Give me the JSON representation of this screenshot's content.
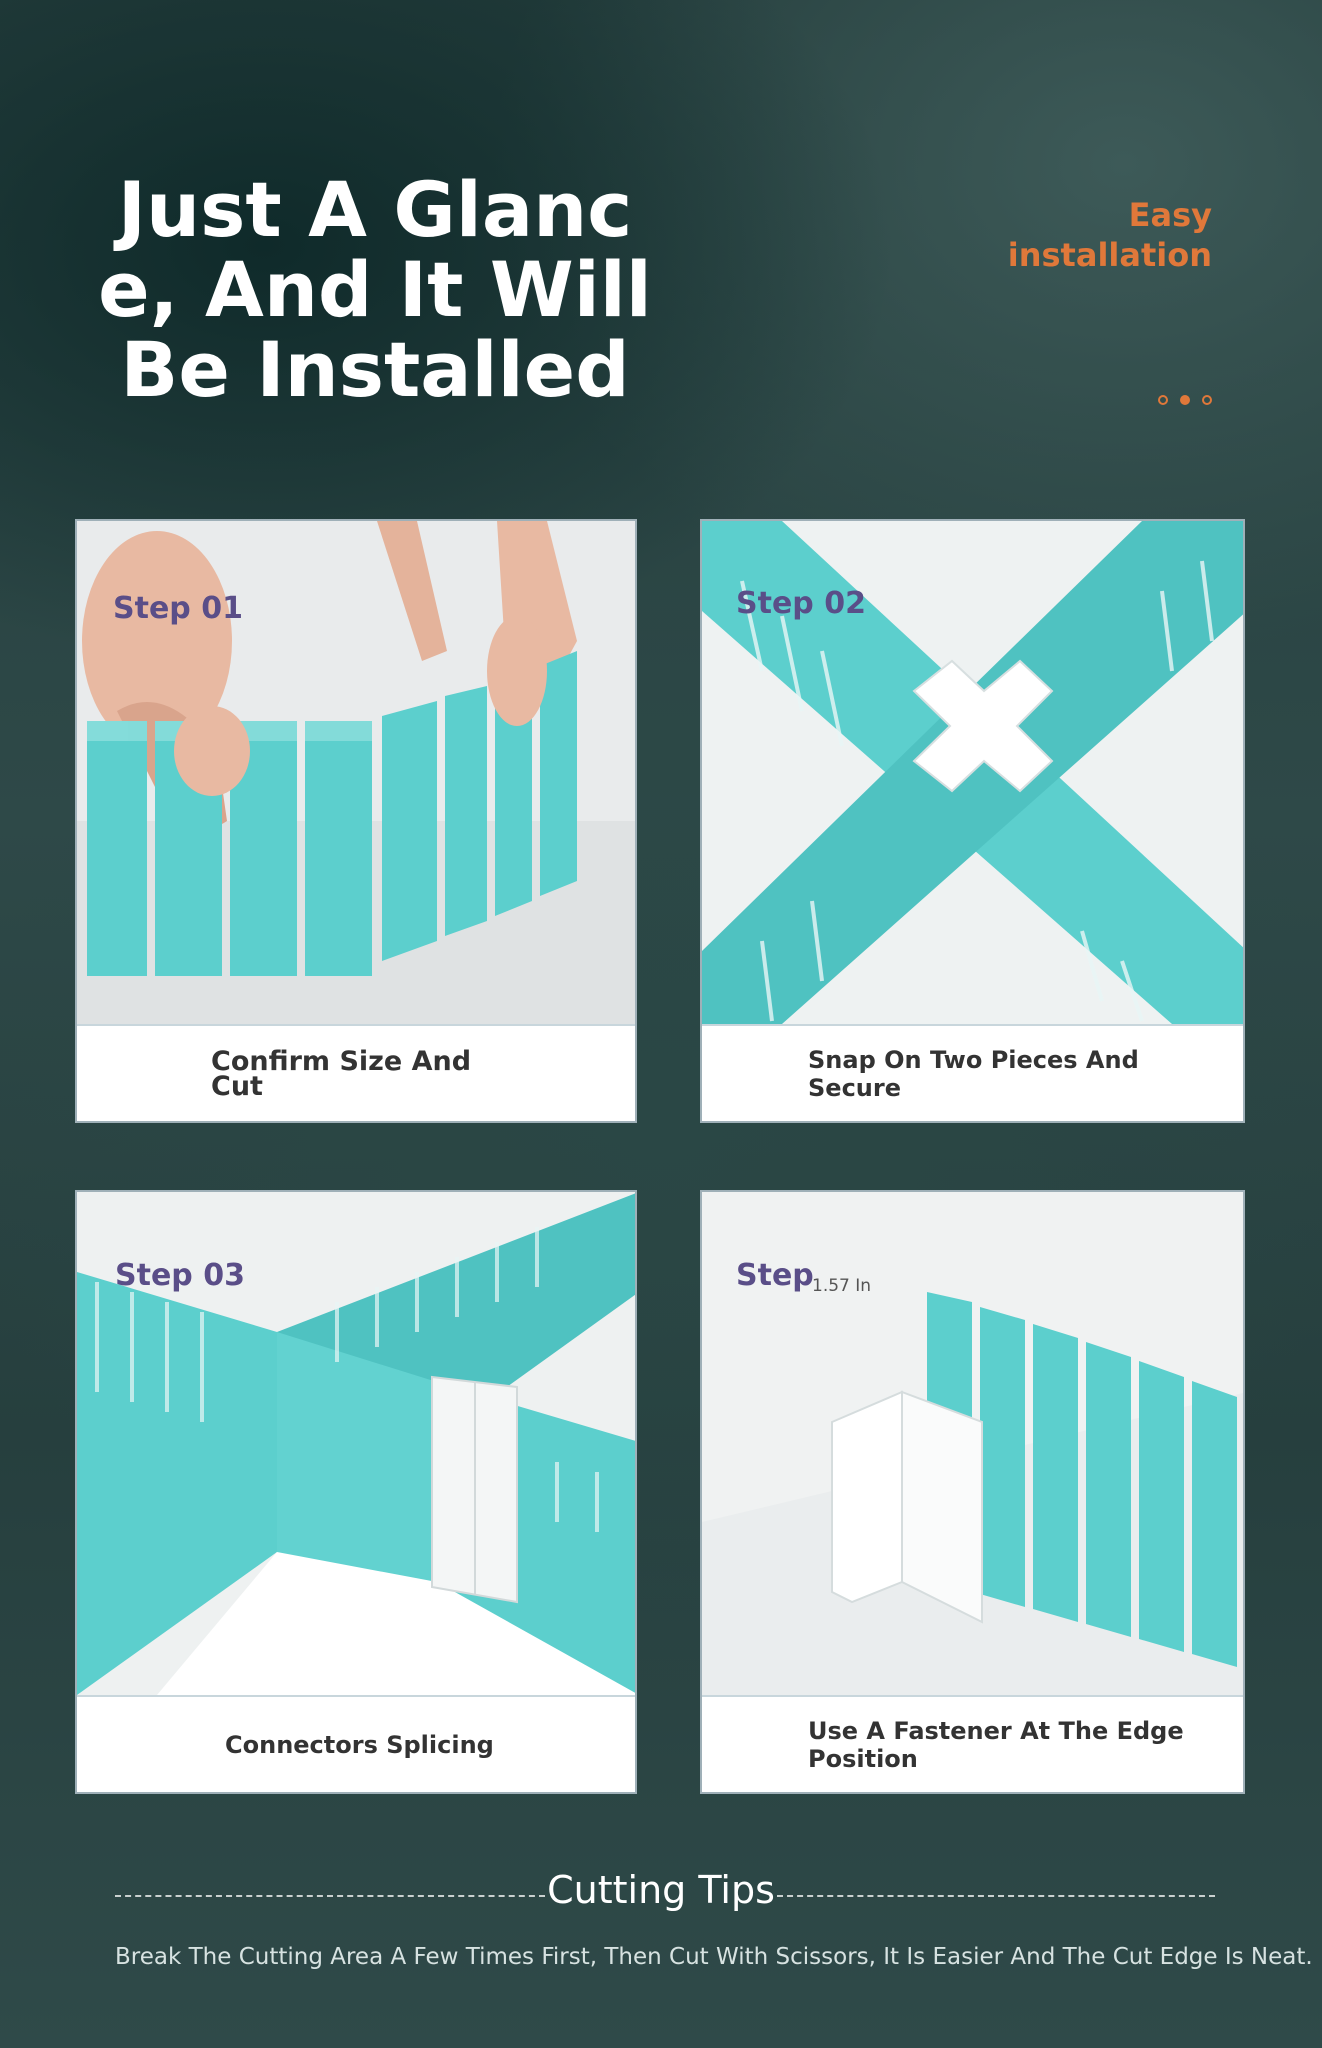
{
  "header": {
    "title": "Just A Glanc\ne, And It Will\nBe Installed",
    "badge": "Easy\ninstallation",
    "accent_color": "#e0783a"
  },
  "steps": [
    {
      "label": "Step 01",
      "caption": "Confirm Size And\n Cut"
    },
    {
      "label": "Step 02",
      "caption": "Snap On Two Pieces And\nSecure"
    },
    {
      "label": "Step 03",
      "caption": "Connectors Splicing"
    },
    {
      "label": "Step",
      "measurement": "1.57 In",
      "caption": "Use A Fastener At The Edge\nPosition"
    }
  ],
  "tips": {
    "title": "Cutting Tips",
    "text": "Break The Cutting Area A Few Times First, Then Cut With Scissors, It Is Easier And The Cut Edge Is Neat."
  },
  "colors": {
    "teal": "#5ccfcd",
    "step_purple": "#5a4e88"
  }
}
